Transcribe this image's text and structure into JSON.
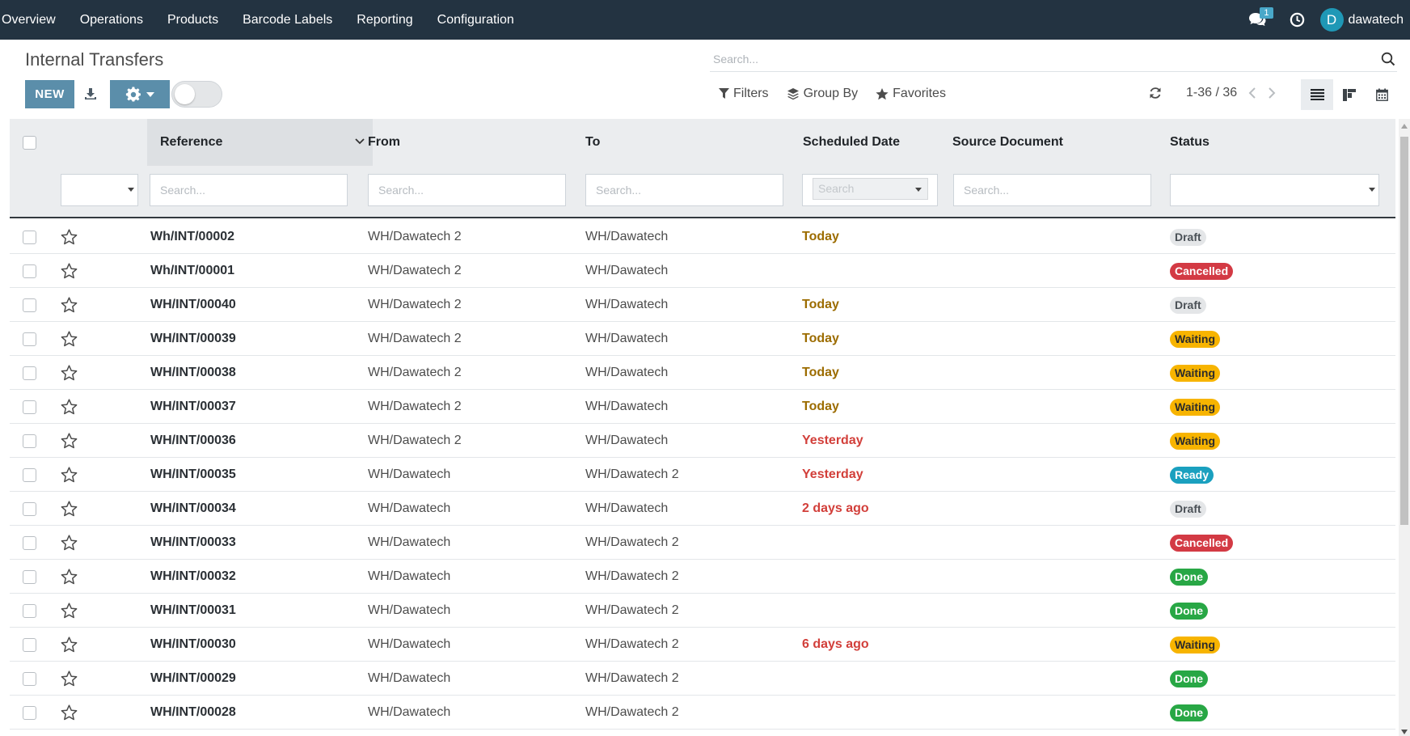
{
  "navbar": {
    "menu": [
      "Overview",
      "Operations",
      "Products",
      "Barcode Labels",
      "Reporting",
      "Configuration"
    ],
    "chat_badge": "1",
    "avatar_letter": "D",
    "username": "dawatech",
    "background": "#233341"
  },
  "control_panel": {
    "title": "Internal Transfers",
    "new_label": "NEW",
    "search_placeholder": "Search...",
    "filters_label": "Filters",
    "group_by_label": "Group By",
    "favorites_label": "Favorites",
    "pager_value": "1-36 / 36",
    "accent": "#5b8eaa"
  },
  "table": {
    "columns": {
      "reference": "Reference",
      "from": "From",
      "to": "To",
      "scheduled_date": "Scheduled Date",
      "source_document": "Source Document",
      "status": "Status"
    },
    "filter_placeholders": {
      "reference": "Search...",
      "from": "Search...",
      "to": "Search...",
      "scheduled_date": "Search",
      "source_document": "Search..."
    },
    "rows": [
      {
        "reference": "Wh/INT/00002",
        "from": "WH/Dawatech 2",
        "to": "WH/Dawatech",
        "date": "Today",
        "date_state": "today",
        "status": "Draft"
      },
      {
        "reference": "Wh/INT/00001",
        "from": "WH/Dawatech 2",
        "to": "WH/Dawatech",
        "date": "",
        "date_state": "",
        "status": "Cancelled"
      },
      {
        "reference": "WH/INT/00040",
        "from": "WH/Dawatech 2",
        "to": "WH/Dawatech",
        "date": "Today",
        "date_state": "today",
        "status": "Draft"
      },
      {
        "reference": "WH/INT/00039",
        "from": "WH/Dawatech 2",
        "to": "WH/Dawatech",
        "date": "Today",
        "date_state": "today",
        "status": "Waiting"
      },
      {
        "reference": "WH/INT/00038",
        "from": "WH/Dawatech 2",
        "to": "WH/Dawatech",
        "date": "Today",
        "date_state": "today",
        "status": "Waiting"
      },
      {
        "reference": "WH/INT/00037",
        "from": "WH/Dawatech 2",
        "to": "WH/Dawatech",
        "date": "Today",
        "date_state": "today",
        "status": "Waiting"
      },
      {
        "reference": "WH/INT/00036",
        "from": "WH/Dawatech 2",
        "to": "WH/Dawatech",
        "date": "Yesterday",
        "date_state": "late",
        "status": "Waiting"
      },
      {
        "reference": "WH/INT/00035",
        "from": "WH/Dawatech",
        "to": "WH/Dawatech 2",
        "date": "Yesterday",
        "date_state": "late",
        "status": "Ready"
      },
      {
        "reference": "WH/INT/00034",
        "from": "WH/Dawatech",
        "to": "WH/Dawatech",
        "date": "2 days ago",
        "date_state": "late",
        "status": "Draft"
      },
      {
        "reference": "WH/INT/00033",
        "from": "WH/Dawatech",
        "to": "WH/Dawatech 2",
        "date": "",
        "date_state": "",
        "status": "Cancelled"
      },
      {
        "reference": "WH/INT/00032",
        "from": "WH/Dawatech",
        "to": "WH/Dawatech 2",
        "date": "",
        "date_state": "",
        "status": "Done"
      },
      {
        "reference": "WH/INT/00031",
        "from": "WH/Dawatech",
        "to": "WH/Dawatech 2",
        "date": "",
        "date_state": "",
        "status": "Done"
      },
      {
        "reference": "WH/INT/00030",
        "from": "WH/Dawatech",
        "to": "WH/Dawatech 2",
        "date": "6 days ago",
        "date_state": "late",
        "status": "Waiting"
      },
      {
        "reference": "WH/INT/00029",
        "from": "WH/Dawatech",
        "to": "WH/Dawatech 2",
        "date": "",
        "date_state": "",
        "status": "Done"
      },
      {
        "reference": "WH/INT/00028",
        "from": "WH/Dawatech",
        "to": "WH/Dawatech 2",
        "date": "",
        "date_state": "",
        "status": "Done"
      }
    ]
  },
  "status_colors": {
    "Draft": {
      "bg": "#e4e6e8",
      "fg": "#4b5157"
    },
    "Cancelled": {
      "bg": "#d33a44",
      "fg": "#ffffff"
    },
    "Waiting": {
      "bg": "#f7b400",
      "fg": "#2b2b2b"
    },
    "Ready": {
      "bg": "#1aa0bf",
      "fg": "#ffffff"
    },
    "Done": {
      "bg": "#28a745",
      "fg": "#ffffff"
    }
  }
}
